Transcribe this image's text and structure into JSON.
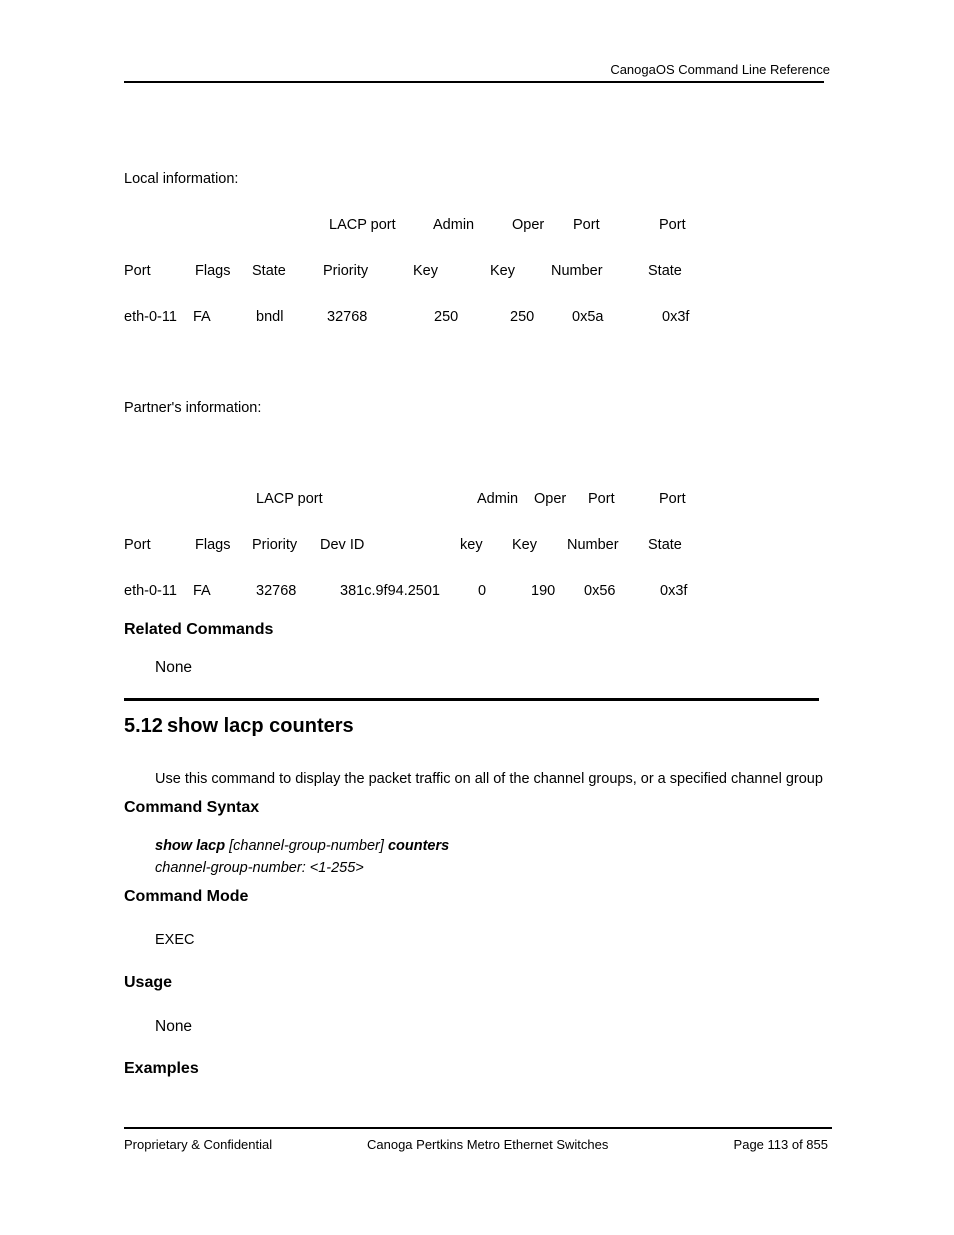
{
  "header": {
    "title": "CanogaOS Command Line Reference"
  },
  "local": {
    "label": "Local information:",
    "header_row1": [
      "LACP port",
      "Admin",
      "Oper",
      "Port",
      "Port"
    ],
    "header_row2": [
      "Port",
      "Flags",
      "State",
      "Priority",
      "Key",
      "Key",
      "Number",
      "State"
    ],
    "rows": [
      [
        "eth-0-11",
        "FA",
        "bndl",
        "32768",
        "250",
        "250",
        "0x5a",
        "0x3f"
      ]
    ]
  },
  "partner": {
    "label": "Partner's information:",
    "header_row1": [
      "LACP port",
      "Admin",
      "Oper",
      "Port",
      "Port"
    ],
    "header_row2": [
      "Port",
      "Flags",
      "Priority",
      "Dev ID",
      "key",
      "Key",
      "Number",
      "State"
    ],
    "rows": [
      [
        "eth-0-11",
        "FA",
        "32768",
        "381c.9f94.2501",
        "0",
        "190",
        "0x56",
        "0x3f"
      ]
    ]
  },
  "related_commands": {
    "heading": "Related Commands",
    "text": "None"
  },
  "section": {
    "number": "5.12",
    "title": "show lacp counters",
    "description": "Use this command to display the packet traffic on all of the channel groups, or a specified channel group",
    "syntax_heading": "Command Syntax",
    "syntax": {
      "cmd": "show lacp",
      "arg": "[channel-group-number]",
      "cmd2": "counters",
      "param": "channel-group-number: <1-255>"
    },
    "mode_heading": "Command Mode",
    "mode": "EXEC",
    "usage_heading": "Usage",
    "usage": "None",
    "examples_heading": "Examples"
  },
  "footer": {
    "left": "Proprietary & Confidential",
    "center": "Canoga Pertkins Metro Ethernet Switches",
    "right": "Page 113 of 855"
  }
}
